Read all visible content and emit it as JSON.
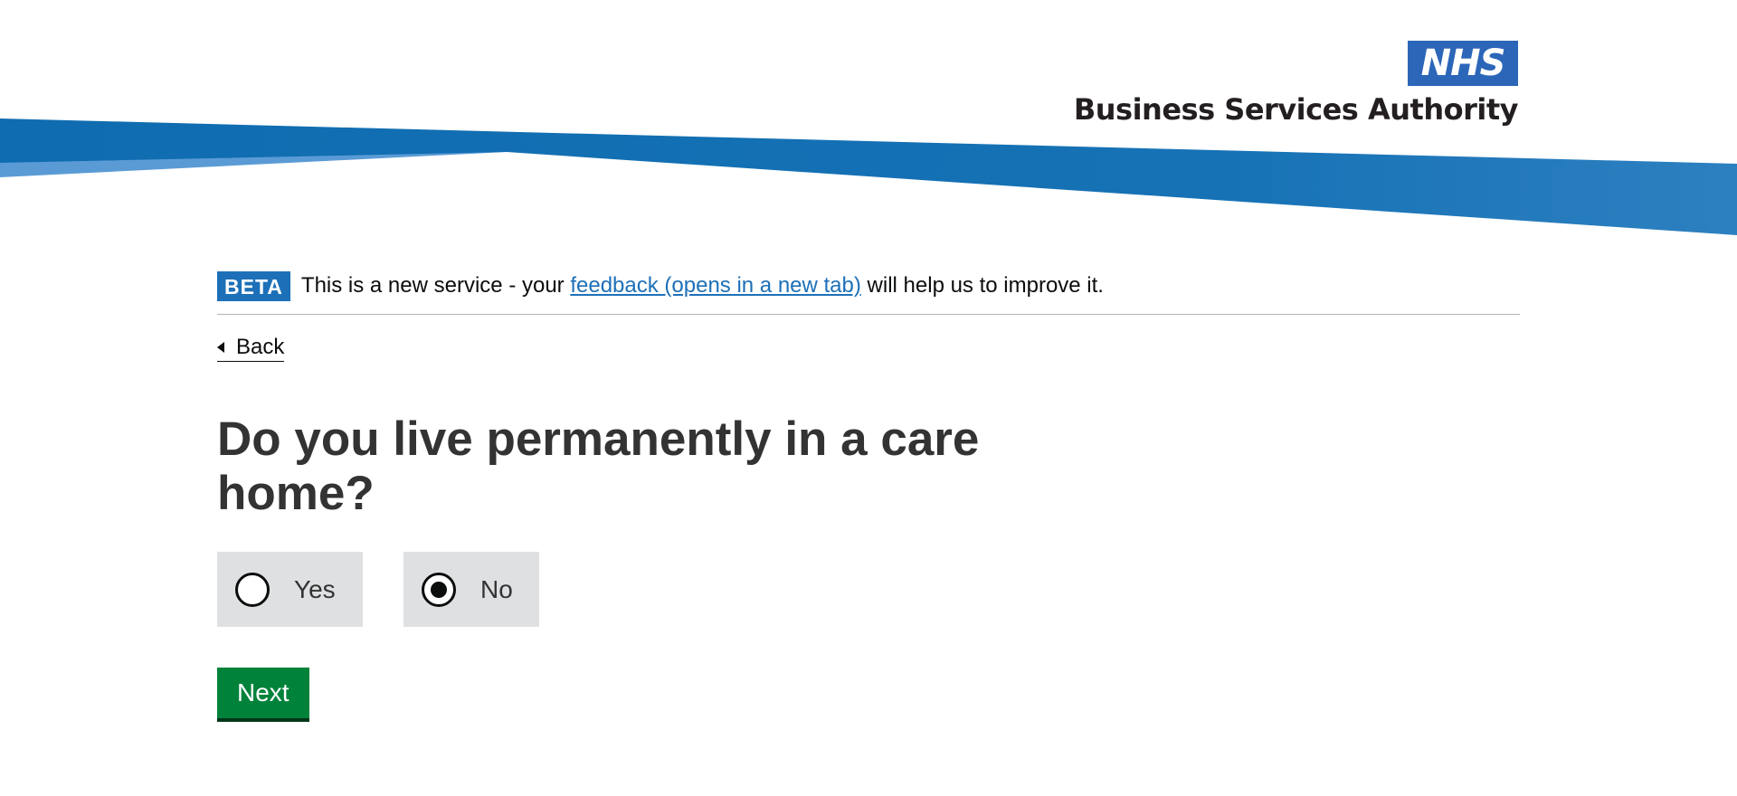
{
  "header": {
    "logo_nhs": "NHS",
    "org_name": "Business Services Authority"
  },
  "phase_banner": {
    "tag": "BETA",
    "text_before": "This is a new service - your ",
    "link_text": "feedback (opens in a new tab)",
    "text_after": " will help us to improve it."
  },
  "back_link": {
    "label": "Back"
  },
  "question": {
    "heading": "Do you live permanently in a care home?"
  },
  "radios": {
    "options": [
      {
        "label": "Yes",
        "selected": false
      },
      {
        "label": "No",
        "selected": true
      }
    ]
  },
  "next_button": {
    "label": "Next"
  },
  "colors": {
    "brand_blue": "#1d70b8",
    "nhs_blue": "#2b66b8",
    "button_green": "#00823b",
    "radio_bg": "#dee0e2"
  }
}
